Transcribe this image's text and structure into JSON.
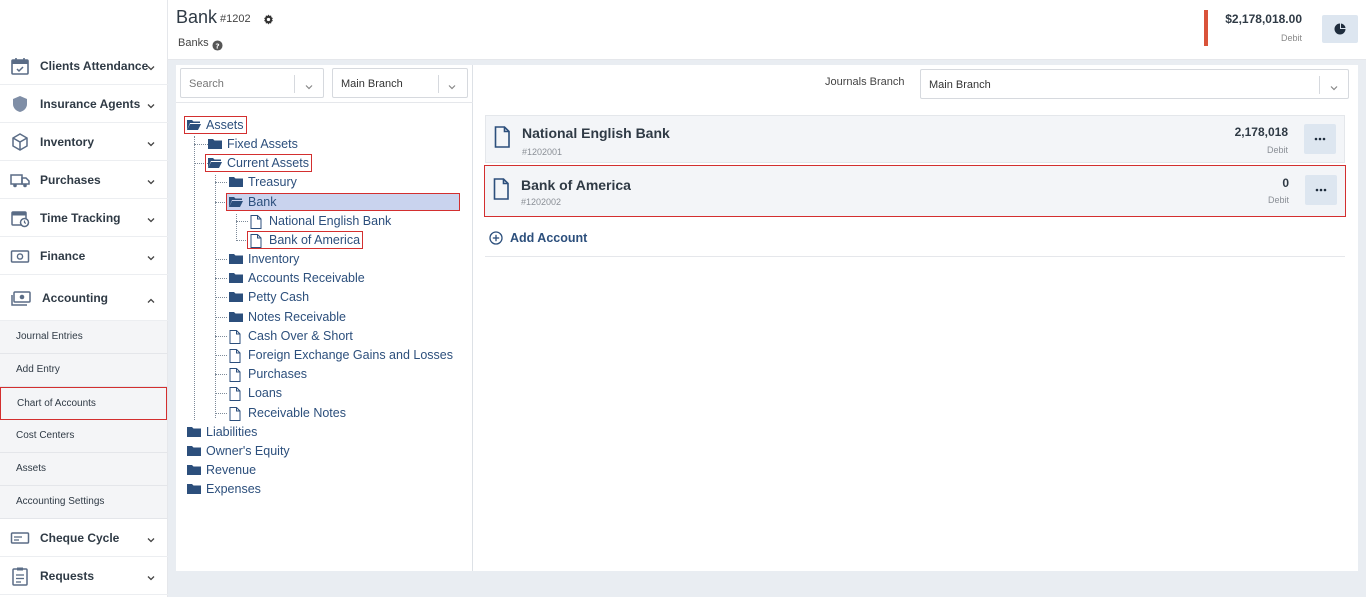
{
  "sidebar": {
    "items": [
      {
        "label": "Clients Attendance",
        "icon": "calendar-check-icon"
      },
      {
        "label": "Insurance Agents",
        "icon": "shield-icon"
      },
      {
        "label": "Inventory",
        "icon": "box-icon"
      },
      {
        "label": "Purchases",
        "icon": "truck-icon"
      },
      {
        "label": "Time Tracking",
        "icon": "calendar-clock-icon"
      },
      {
        "label": "Finance",
        "icon": "money-icon"
      },
      {
        "label": "Accounting",
        "icon": "cash-stack-icon"
      },
      {
        "label": "Cheque Cycle",
        "icon": "cheque-icon"
      },
      {
        "label": "Requests",
        "icon": "clipboard-icon"
      }
    ],
    "accounting_sub": [
      {
        "label": "Journal Entries"
      },
      {
        "label": "Add Entry"
      },
      {
        "label": "Chart of Accounts"
      },
      {
        "label": "Cost Centers"
      },
      {
        "label": "Assets"
      },
      {
        "label": "Accounting Settings"
      }
    ]
  },
  "header": {
    "title": "Bank",
    "code": "#1202",
    "breadcrumb": "Banks",
    "balance": "$2,178,018.00",
    "balance_side": "Debit"
  },
  "tree_panel": {
    "search_placeholder": "Search",
    "branch": "Main Branch"
  },
  "tree": {
    "assets": "Assets",
    "fixed_assets": "Fixed Assets",
    "current_assets": "Current Assets",
    "treasury": "Treasury",
    "bank": "Bank",
    "national_english_bank": "National English Bank",
    "bank_of_america": "Bank of America",
    "inventory": "Inventory",
    "accounts_receivable": "Accounts Receivable",
    "petty_cash": "Petty Cash",
    "notes_receivable": "Notes Receivable",
    "cash_over_short": "Cash Over & Short",
    "fx_gains_losses": "Foreign Exchange Gains and Losses",
    "purchases": "Purchases",
    "loans": "Loans",
    "receivable_notes": "Receivable Notes",
    "liabilities": "Liabilities",
    "owners_equity": "Owner's Equity",
    "revenue": "Revenue",
    "expenses": "Expenses"
  },
  "detail": {
    "journals_branch_label": "Journals Branch",
    "journals_branch_value": "Main Branch",
    "accounts": [
      {
        "name": "National English Bank",
        "code": "#1202001",
        "amount": "2,178,018",
        "side": "Debit"
      },
      {
        "name": "Bank of America",
        "code": "#1202002",
        "amount": "0",
        "side": "Debit"
      }
    ],
    "add_account_label": "Add Account"
  },
  "colors": {
    "accent": "#2c4f7c",
    "highlight_border": "#d32f2f",
    "balance_bar": "#d9533a"
  }
}
